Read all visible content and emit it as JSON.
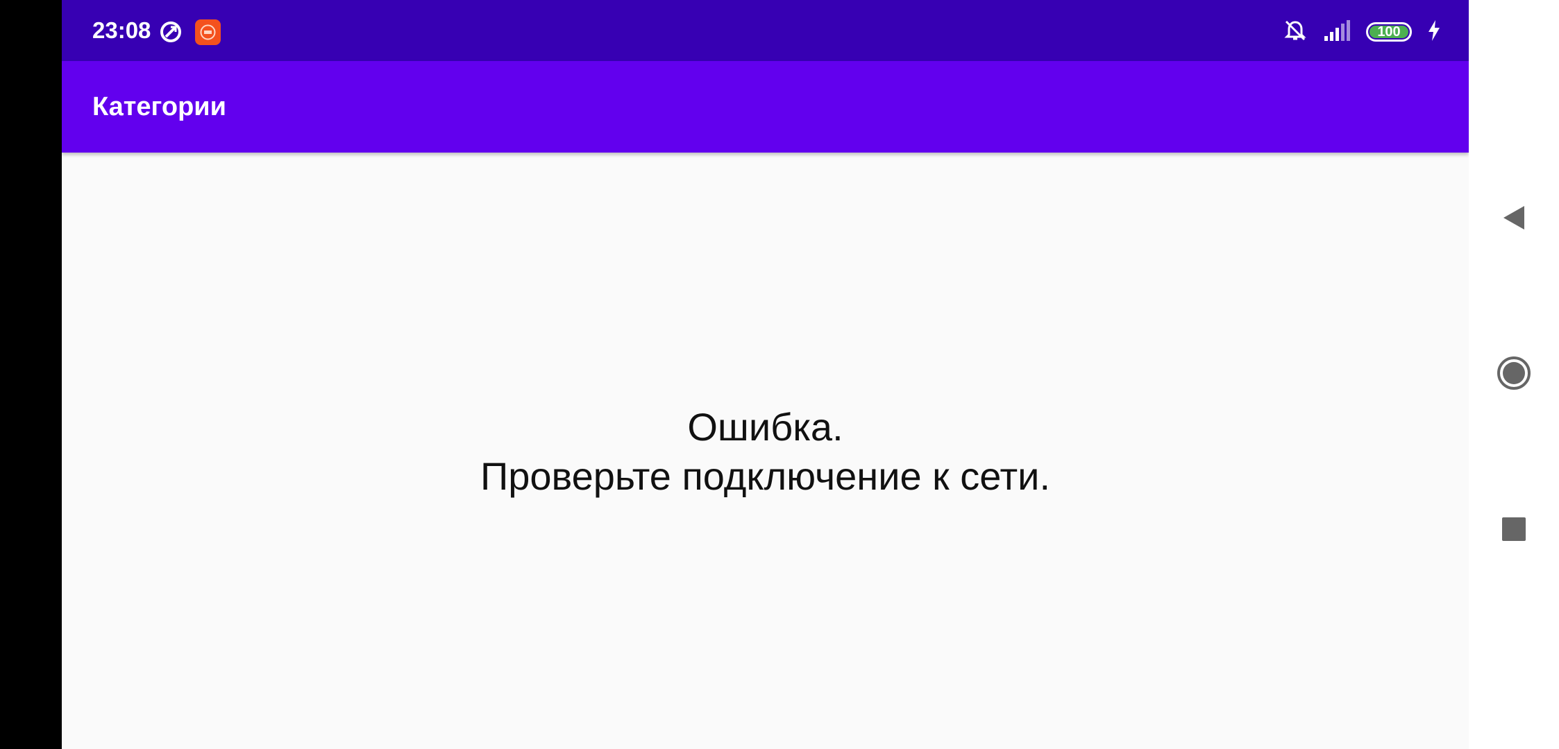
{
  "status_bar": {
    "time": "23:08",
    "battery_level": "100",
    "left_icons": [
      "autorotate-icon",
      "app-notification-icon"
    ],
    "right_icons": [
      "mute-bell-icon",
      "signal-icon",
      "battery-icon",
      "charging-icon"
    ],
    "colors": {
      "background": "#3700b3",
      "battery_fill": "#4caf50",
      "app_icon": "#f4511e"
    }
  },
  "app_bar": {
    "title": "Категории",
    "color": "#6200ee"
  },
  "content": {
    "error_title": "Ошибка.",
    "error_detail": "Проверьте подключение к сети."
  },
  "navigation_bar": {
    "buttons": [
      "back-icon",
      "home-icon",
      "recents-icon"
    ]
  }
}
